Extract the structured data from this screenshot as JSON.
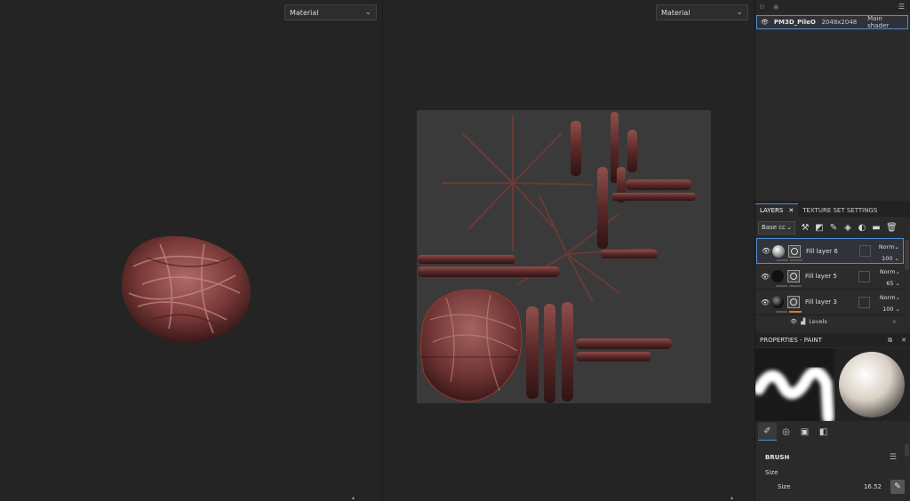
{
  "viewport3d": {
    "mode": "Material"
  },
  "viewport2d": {
    "mode": "Material"
  },
  "texture_set": {
    "name": "PM3D_PileOf...",
    "resolution": "2048x2048",
    "shader": "Main shader"
  },
  "tabs": {
    "layers": "LAYERS",
    "texture_set_settings": "TEXTURE SET SETTINGS"
  },
  "layer_toolbar": {
    "channel": "Base cc"
  },
  "layers": [
    {
      "name": "Fill layer 6",
      "blend": "Norm",
      "opacity": "100"
    },
    {
      "name": "Fill layer 5",
      "blend": "Norm",
      "opacity": "65"
    },
    {
      "name": "Fill layer 3",
      "blend": "Norm",
      "opacity": "100"
    }
  ],
  "effect": {
    "name": "Levels"
  },
  "properties": {
    "title": "PROPERTIES - PAINT"
  },
  "brush": {
    "section": "BRUSH",
    "group": "Size",
    "param": "Size",
    "value": "16.52"
  },
  "colors": {
    "accent": "#4a8fd8",
    "mask_bar": "#e07a1e",
    "uv_bg": "#3a3a3a"
  }
}
